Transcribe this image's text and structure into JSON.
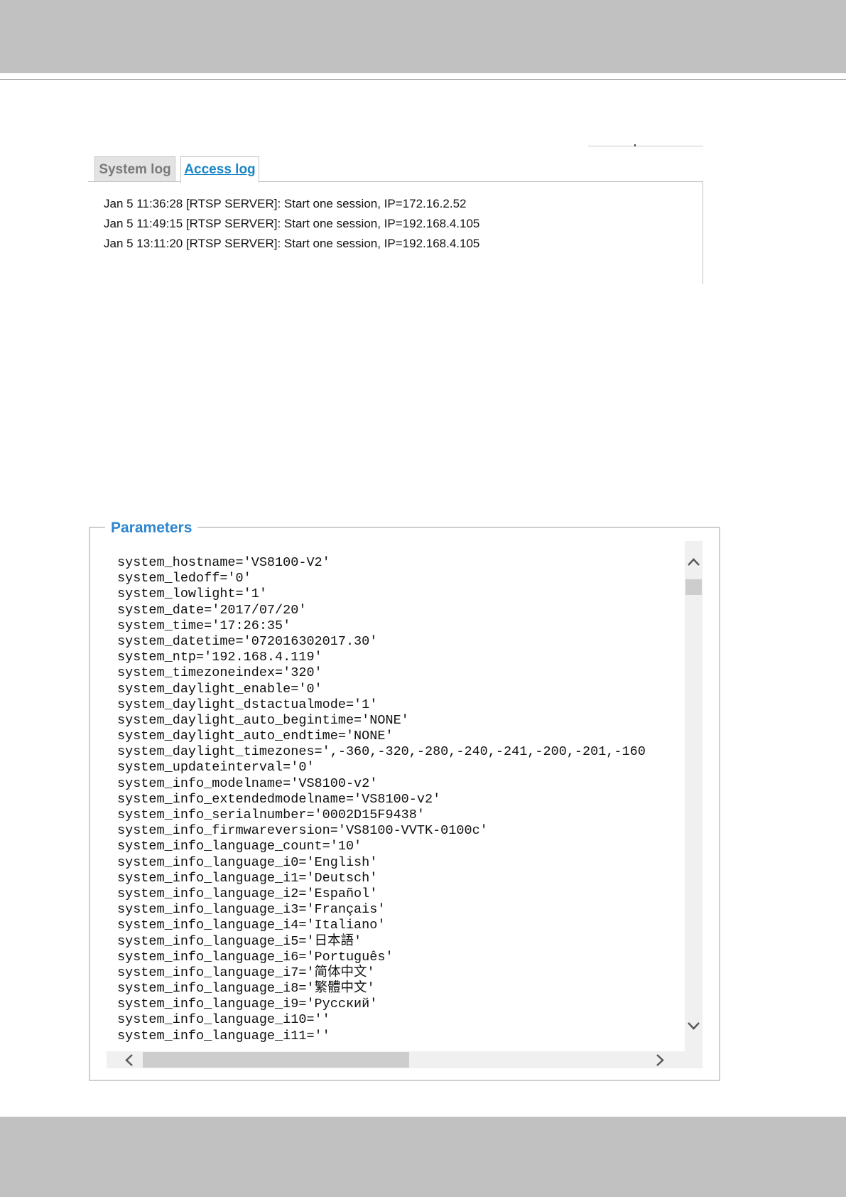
{
  "tabs": {
    "system_log": "System log",
    "access_log": "Access log"
  },
  "access_log": {
    "entries": [
      "Jan 5 11:36:28 [RTSP SERVER]: Start one session, IP=172.16.2.52",
      "Jan 5 11:49:15 [RTSP SERVER]: Start one session, IP=192.168.4.105",
      "Jan 5 13:11:20 [RTSP SERVER]: Start one session, IP=192.168.4.105"
    ]
  },
  "parameters": {
    "legend": "Parameters",
    "lines": [
      "system_hostname='VS8100-V2'",
      "system_ledoff='0'",
      "system_lowlight='1'",
      "system_date='2017/07/20'",
      "system_time='17:26:35'",
      "system_datetime='072016302017.30'",
      "system_ntp='192.168.4.119'",
      "system_timezoneindex='320'",
      "system_daylight_enable='0'",
      "system_daylight_dstactualmode='1'",
      "system_daylight_auto_begintime='NONE'",
      "system_daylight_auto_endtime='NONE'",
      "system_daylight_timezones=',-360,-320,-280,-240,-241,-200,-201,-160",
      "system_updateinterval='0'",
      "system_info_modelname='VS8100-v2'",
      "system_info_extendedmodelname='VS8100-v2'",
      "system_info_serialnumber='0002D15F9438'",
      "system_info_firmwareversion='VS8100-VVTK-0100c'",
      "system_info_language_count='10'",
      "system_info_language_i0='English'",
      "system_info_language_i1='Deutsch'",
      "system_info_language_i2='Español'",
      "system_info_language_i3='Français'",
      "system_info_language_i4='Italiano'",
      "system_info_language_i5='日本語'",
      "system_info_language_i6='Português'",
      "system_info_language_i7='简体中文'",
      "system_info_language_i8='繁體中文'",
      "system_info_language_i9='Русский'",
      "system_info_language_i10=''",
      "system_info_language_i11=''"
    ]
  },
  "scrollbars": {
    "vertical_up_icon": "chevron-up-icon",
    "vertical_down_icon": "chevron-down-icon",
    "horizontal_left_icon": "chevron-left-icon",
    "horizontal_right_icon": "chevron-right-icon"
  },
  "colors": {
    "band": "#c1c1c1",
    "accent": "#2f86cf",
    "tab_link": "#1a86c7"
  }
}
